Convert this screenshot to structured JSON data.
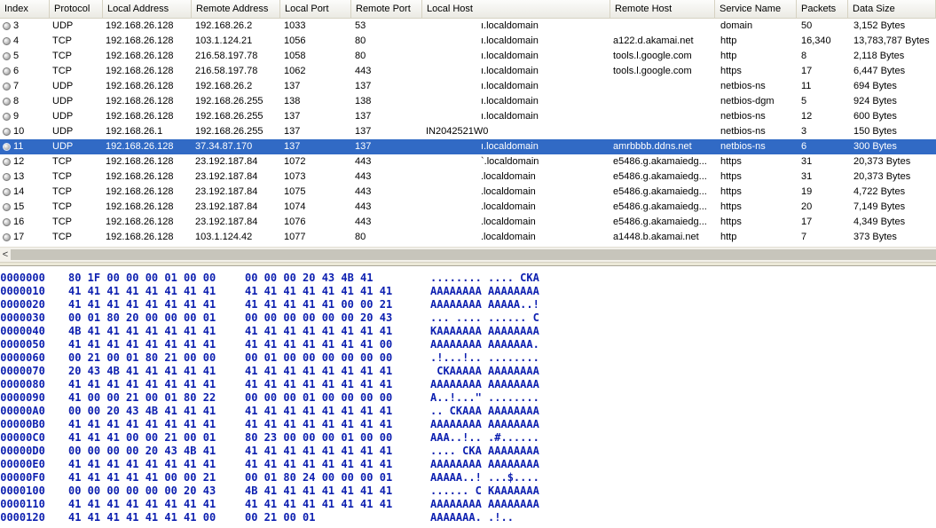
{
  "columns": [
    "Index",
    "Protocol",
    "Local Address",
    "Remote Address",
    "Local Port",
    "Remote Port",
    "Local Host",
    "Remote Host",
    "Service Name",
    "Packets",
    "Data Size"
  ],
  "rows": [
    [
      "3",
      "UDP",
      "192.168.26.128",
      "192.168.26.2",
      "1033",
      "53",
      "ı.localdomain",
      "",
      "domain",
      "50",
      "3,152 Bytes"
    ],
    [
      "4",
      "TCP",
      "192.168.26.128",
      "103.1.124.21",
      "1056",
      "80",
      "ı.localdomain",
      "a122.d.akamai.net",
      "http",
      "16,340",
      "13,783,787 Bytes"
    ],
    [
      "5",
      "TCP",
      "192.168.26.128",
      "216.58.197.78",
      "1058",
      "80",
      "ı.localdomain",
      "tools.l.google.com",
      "http",
      "8",
      "2,118 Bytes"
    ],
    [
      "6",
      "TCP",
      "192.168.26.128",
      "216.58.197.78",
      "1062",
      "443",
      "ı.localdomain",
      "tools.l.google.com",
      "https",
      "17",
      "6,447 Bytes"
    ],
    [
      "7",
      "UDP",
      "192.168.26.128",
      "192.168.26.2",
      "137",
      "137",
      "ı.localdomain",
      "",
      "netbios-ns",
      "11",
      "694 Bytes"
    ],
    [
      "8",
      "UDP",
      "192.168.26.128",
      "192.168.26.255",
      "138",
      "138",
      "ı.localdomain",
      "",
      "netbios-dgm",
      "5",
      "924 Bytes"
    ],
    [
      "9",
      "UDP",
      "192.168.26.128",
      "192.168.26.255",
      "137",
      "137",
      "ı.localdomain",
      "",
      "netbios-ns",
      "12",
      "600 Bytes"
    ],
    [
      "10",
      "UDP",
      "192.168.26.1",
      "192.168.26.255",
      "137",
      "137",
      "IN2042521W0",
      "",
      "netbios-ns",
      "3",
      "150 Bytes"
    ],
    [
      "11",
      "UDP",
      "192.168.26.128",
      "37.34.87.170",
      "137",
      "137",
      "ı.localdomain",
      "amrbbbb.ddns.net",
      "netbios-ns",
      "6",
      "300 Bytes"
    ],
    [
      "12",
      "TCP",
      "192.168.26.128",
      "23.192.187.84",
      "1072",
      "443",
      "`.localdomain",
      "e5486.g.akamaiedg...",
      "https",
      "31",
      "20,373 Bytes"
    ],
    [
      "13",
      "TCP",
      "192.168.26.128",
      "23.192.187.84",
      "1073",
      "443",
      ".localdomain",
      "e5486.g.akamaiedg...",
      "https",
      "31",
      "20,373 Bytes"
    ],
    [
      "14",
      "TCP",
      "192.168.26.128",
      "23.192.187.84",
      "1075",
      "443",
      ".localdomain",
      "e5486.g.akamaiedg...",
      "https",
      "19",
      "4,722 Bytes"
    ],
    [
      "15",
      "TCP",
      "192.168.26.128",
      "23.192.187.84",
      "1074",
      "443",
      ".localdomain",
      "e5486.g.akamaiedg...",
      "https",
      "20",
      "7,149 Bytes"
    ],
    [
      "16",
      "TCP",
      "192.168.26.128",
      "23.192.187.84",
      "1076",
      "443",
      ".localdomain",
      "e5486.g.akamaiedg...",
      "https",
      "17",
      "4,349 Bytes"
    ],
    [
      "17",
      "TCP",
      "192.168.26.128",
      "103.1.124.42",
      "1077",
      "80",
      ".localdomain",
      "a1448.b.akamai.net",
      "http",
      "7",
      "373 Bytes"
    ]
  ],
  "selected_index": "11",
  "scroll_left_arrow": "<",
  "hex_dump": [
    {
      "offset": "00000000",
      "hex1": "80 1F 00 00 00 01 00 00",
      "hex2": "00 00 00 20 43 4B 41",
      "ascii": "........ .... CKA"
    },
    {
      "offset": "00000010",
      "hex1": "41 41 41 41 41 41 41 41",
      "hex2": "41 41 41 41 41 41 41 41",
      "ascii": "AAAAAAAA AAAAAAAA"
    },
    {
      "offset": "00000020",
      "hex1": "41 41 41 41 41 41 41 41",
      "hex2": "41 41 41 41 41 00 00 21",
      "ascii": "AAAAAAAA AAAAA..!"
    },
    {
      "offset": "00000030",
      "hex1": "00 01 80 20 00 00 00 01",
      "hex2": "00 00 00 00 00 00 20 43",
      "ascii": "... .... ...... C"
    },
    {
      "offset": "00000040",
      "hex1": "4B 41 41 41 41 41 41 41",
      "hex2": "41 41 41 41 41 41 41 41",
      "ascii": "KAAAAAAA AAAAAAAA"
    },
    {
      "offset": "00000050",
      "hex1": "41 41 41 41 41 41 41 41",
      "hex2": "41 41 41 41 41 41 41 00",
      "ascii": "AAAAAAAA AAAAAAA."
    },
    {
      "offset": "00000060",
      "hex1": "00 21 00 01 80 21 00 00",
      "hex2": "00 01 00 00 00 00 00 00",
      "ascii": ".!...!.. ........"
    },
    {
      "offset": "00000070",
      "hex1": "20 43 4B 41 41 41 41 41",
      "hex2": "41 41 41 41 41 41 41 41",
      "ascii": " CKAAAAA AAAAAAAA"
    },
    {
      "offset": "00000080",
      "hex1": "41 41 41 41 41 41 41 41",
      "hex2": "41 41 41 41 41 41 41 41",
      "ascii": "AAAAAAAA AAAAAAAA"
    },
    {
      "offset": "00000090",
      "hex1": "41 00 00 21 00 01 80 22",
      "hex2": "00 00 00 01 00 00 00 00",
      "ascii": "A..!...\" ........"
    },
    {
      "offset": "000000A0",
      "hex1": "00 00 20 43 4B 41 41 41",
      "hex2": "41 41 41 41 41 41 41 41",
      "ascii": ".. CKAAA AAAAAAAA"
    },
    {
      "offset": "000000B0",
      "hex1": "41 41 41 41 41 41 41 41",
      "hex2": "41 41 41 41 41 41 41 41",
      "ascii": "AAAAAAAA AAAAAAAA"
    },
    {
      "offset": "000000C0",
      "hex1": "41 41 41 00 00 21 00 01",
      "hex2": "80 23 00 00 00 01 00 00",
      "ascii": "AAA..!.. .#......"
    },
    {
      "offset": "000000D0",
      "hex1": "00 00 00 00 20 43 4B 41",
      "hex2": "41 41 41 41 41 41 41 41",
      "ascii": ".... CKA AAAAAAAA"
    },
    {
      "offset": "000000E0",
      "hex1": "41 41 41 41 41 41 41 41",
      "hex2": "41 41 41 41 41 41 41 41",
      "ascii": "AAAAAAAA AAAAAAAA"
    },
    {
      "offset": "000000F0",
      "hex1": "41 41 41 41 41 00 00 21",
      "hex2": "00 01 80 24 00 00 00 01",
      "ascii": "AAAAA..! ...$...."
    },
    {
      "offset": "00000100",
      "hex1": "00 00 00 00 00 00 20 43",
      "hex2": "4B 41 41 41 41 41 41 41",
      "ascii": "...... C KAAAAAAA"
    },
    {
      "offset": "00000110",
      "hex1": "41 41 41 41 41 41 41 41",
      "hex2": "41 41 41 41 41 41 41 41",
      "ascii": "AAAAAAAA AAAAAAAA"
    },
    {
      "offset": "00000120",
      "hex1": "41 41 41 41 41 41 41 00",
      "hex2": "00 21 00 01",
      "ascii": "AAAAAAA. .!.."
    }
  ]
}
